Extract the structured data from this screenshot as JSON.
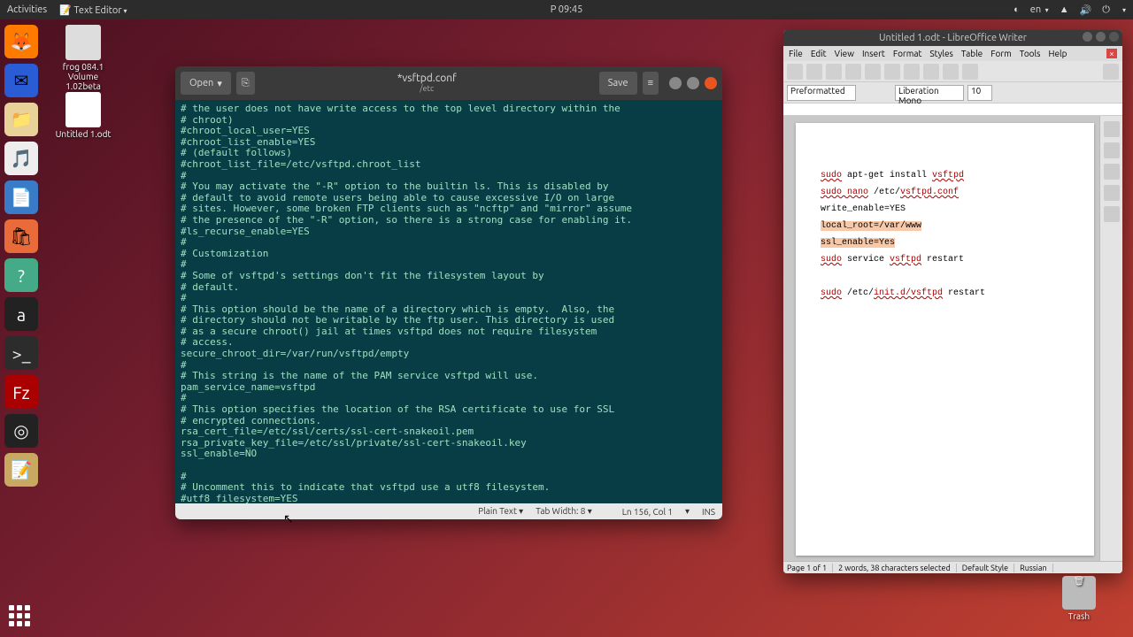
{
  "panel": {
    "activities": "Activities",
    "app_indicator": "Text Editor",
    "clock": "P  09:45",
    "lang": "en"
  },
  "desktop": {
    "usb": {
      "label1": "frog 084.1",
      "label2": "Volume",
      "label3": "1.02beta"
    },
    "doc": "Untitled 1.odt",
    "trash": "Trash"
  },
  "gedit": {
    "open": "Open",
    "save": "Save",
    "title": "*vsftpd.conf",
    "subtitle": "/etc",
    "body": "# the user does not have write access to the top level directory within the\n# chroot)\n#chroot_local_user=YES\n#chroot_list_enable=YES\n# (default follows)\n#chroot_list_file=/etc/vsftpd.chroot_list\n#\n# You may activate the \"-R\" option to the builtin ls. This is disabled by\n# default to avoid remote users being able to cause excessive I/O on large\n# sites. However, some broken FTP clients such as \"ncftp\" and \"mirror\" assume\n# the presence of the \"-R\" option, so there is a strong case for enabling it.\n#ls_recurse_enable=YES\n#\n# Customization\n#\n# Some of vsftpd's settings don't fit the filesystem layout by\n# default.\n#\n# This option should be the name of a directory which is empty.  Also, the\n# directory should not be writable by the ftp user. This directory is used\n# as a secure chroot() jail at times vsftpd does not require filesystem\n# access.\nsecure_chroot_dir=/var/run/vsftpd/empty\n#\n# This string is the name of the PAM service vsftpd will use.\npam_service_name=vsftpd\n#\n# This option specifies the location of the RSA certificate to use for SSL\n# encrypted connections.\nrsa_cert_file=/etc/ssl/certs/ssl-cert-snakeoil.pem\nrsa_private_key_file=/etc/ssl/private/ssl-cert-snakeoil.key\nssl_enable=NO\n\n#\n# Uncomment this to indicate that vsftpd use a utf8 filesystem.\n#utf8_filesystem=YES",
    "status": {
      "syntax": "Plain Text",
      "tabwidth": "Tab Width: 8",
      "position": "Ln 156, Col 1",
      "insert": "INS"
    }
  },
  "lo": {
    "title": "Untitled 1.odt - LibreOffice Writer",
    "menu": [
      "File",
      "Edit",
      "View",
      "Insert",
      "Format",
      "Styles",
      "Table",
      "Form",
      "Tools",
      "Help"
    ],
    "para_style": "Preformatted",
    "font_name": "Liberation Mono",
    "font_size": "10",
    "doc": {
      "l1a": "sudo",
      "l1b": " apt-get install ",
      "l1c": "vsftpd",
      "l2a": "sudo nano",
      "l2b": " /etc/",
      "l2c": "vsftpd.conf",
      "l3": "write_enable=YES",
      "l4": "local_root=/var/www",
      "l5": "ssl_enable=Yes",
      "l6a": "sudo",
      "l6b": " service ",
      "l6c": "vsftpd",
      "l6d": " restart",
      "l7a": "sudo",
      "l7b": " /etc/",
      "l7c": "init.d/vsftpd",
      "l7d": " restart"
    },
    "status": {
      "page": "Page 1 of 1",
      "words": "2 words, 38 characters selected",
      "style": "Default Style",
      "lang": "Russian"
    }
  }
}
